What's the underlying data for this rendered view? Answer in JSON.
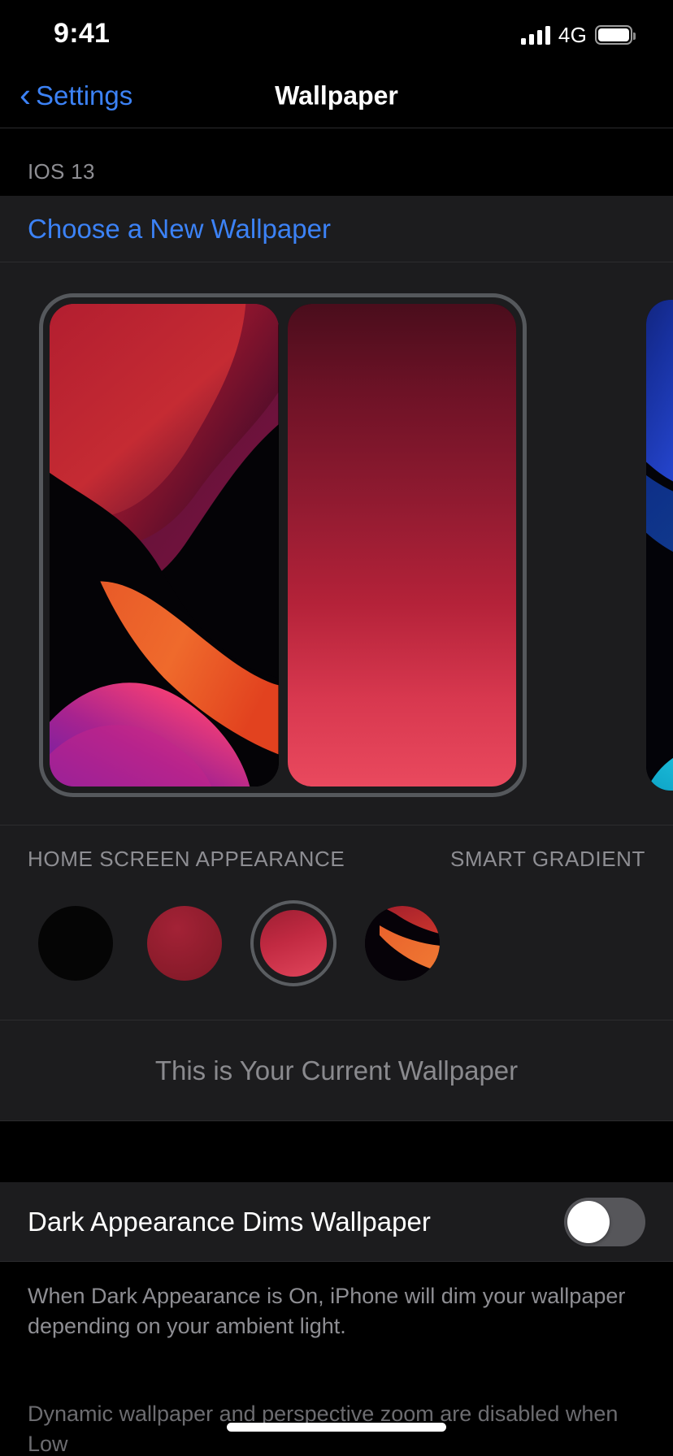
{
  "status_bar": {
    "time": "9:41",
    "network": "4G",
    "signal_icon": "cellular-bars-icon",
    "battery_icon": "battery-full-icon"
  },
  "nav_bar": {
    "back_label": "Settings",
    "back_icon": "chevron-left-icon",
    "title": "Wallpaper"
  },
  "sections": {
    "ios13": {
      "header": "IOS 13",
      "choose_label": "Choose a New Wallpaper"
    }
  },
  "preview": {
    "left_pane_name": "ios-13-dark-wallpaper-preview",
    "right_pane_name": "smart-gradient-preview",
    "peek_pane_name": "ios-13-blue-wallpaper-preview"
  },
  "appearance": {
    "left_label": "HOME SCREEN APPEARANCE",
    "right_label": "SMART GRADIENT",
    "swatches": [
      {
        "name": "swatch-black",
        "selected": false,
        "color": "#050505"
      },
      {
        "name": "swatch-dark-red",
        "selected": false,
        "color": "#8d1c2c"
      },
      {
        "name": "swatch-red-gradient",
        "selected": true,
        "color": "#c22a42"
      },
      {
        "name": "swatch-wallpaper-photo",
        "selected": false,
        "color": "#e2543a"
      }
    ]
  },
  "current_wallpaper_label": "This is Your Current Wallpaper",
  "dark_dims": {
    "label": "Dark Appearance Dims Wallpaper",
    "value": "off"
  },
  "footers": {
    "primary": "When Dark Appearance is On, iPhone will dim your wallpaper depending on your ambient light.",
    "secondary": "Dynamic wallpaper and perspective zoom are disabled when Low"
  },
  "colors": {
    "accent_blue": "#3c82f6",
    "group_background": "#1c1c1e",
    "page_background": "#000000",
    "secondary_text": "#8e8e93"
  }
}
